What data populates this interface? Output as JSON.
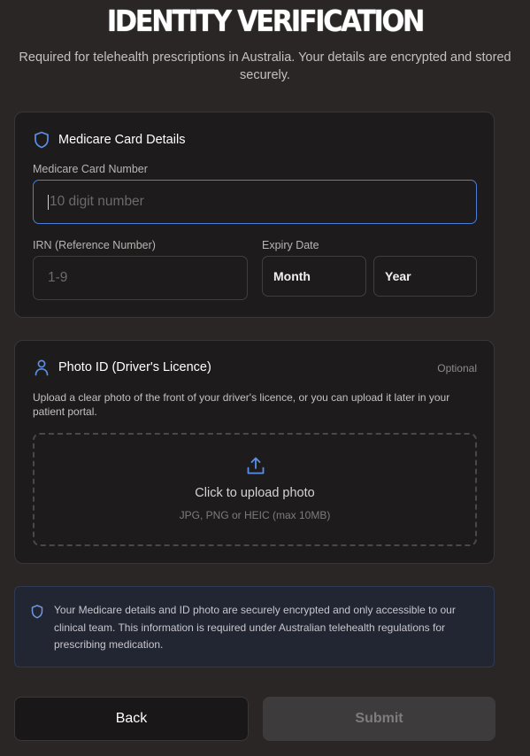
{
  "header": {
    "title": "IDENTITY VERIFICATION",
    "subtitle": "Required for telehealth prescriptions in Australia. Your details are encrypted and stored securely."
  },
  "medicare": {
    "heading": "Medicare Card Details",
    "icon": "shield-icon",
    "card_number_label": "Medicare Card Number",
    "card_number_placeholder": "10 digit number",
    "card_number_value": "",
    "irn_label": "IRN (Reference Number)",
    "irn_placeholder": "1-9",
    "irn_value": "",
    "expiry_label": "Expiry Date",
    "month_value": "Month",
    "year_value": "Year"
  },
  "photo_id": {
    "heading": "Photo ID (Driver's Licence)",
    "icon": "user-icon",
    "optional_label": "Optional",
    "description": "Upload a clear photo of the front of your driver's licence, or you can upload it later in your patient portal.",
    "upload_icon": "upload-icon",
    "upload_title": "Click to upload photo",
    "upload_hint": "JPG, PNG or HEIC (max 10MB)"
  },
  "notice": {
    "icon": "shield-icon",
    "text": "Your Medicare details and ID photo are securely encrypted and only accessible to our clinical team. This information is required under Australian telehealth regulations for prescribing medication."
  },
  "actions": {
    "back_label": "Back",
    "submit_label": "Submit"
  },
  "colors": {
    "background": "#2a2626",
    "card": "#1e1b1c",
    "accent": "#4a7ed8",
    "notice_bg": "#222633"
  }
}
